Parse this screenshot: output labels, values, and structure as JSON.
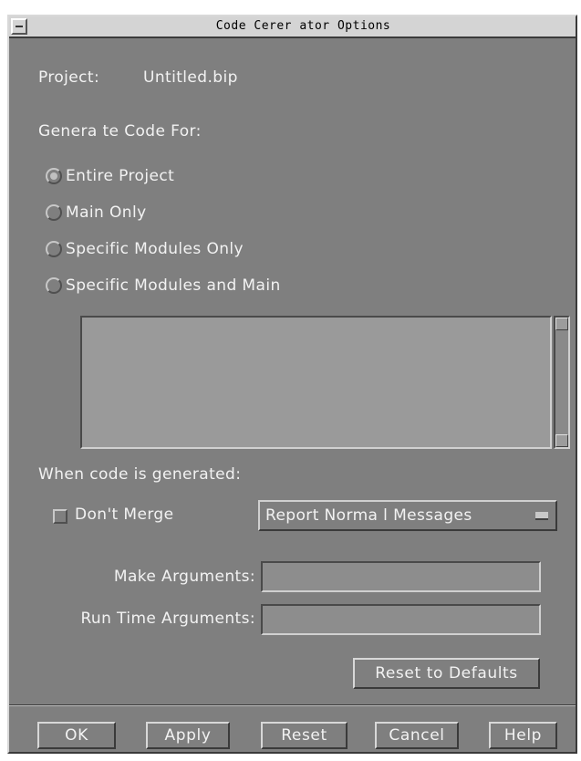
{
  "window": {
    "title": "Code Cerer ator Options"
  },
  "project": {
    "label": "Project:",
    "value": "Untitled.bip"
  },
  "generate": {
    "heading": "Genera te Code For:",
    "options": [
      {
        "label": "Entire Project",
        "checked": true
      },
      {
        "label": "Main Only",
        "checked": false
      },
      {
        "label": "Specific Modules Only",
        "checked": false
      },
      {
        "label": "Specific Modules and Main",
        "checked": false
      }
    ]
  },
  "when": {
    "heading": "When code is generated:",
    "dont_merge": {
      "label": "Don't Merge",
      "checked": false
    },
    "message_level": {
      "selected": "Report Norma l Messages"
    }
  },
  "make_args": {
    "label": "Make Arguments:",
    "value": ""
  },
  "runtime_args": {
    "label": "Run Time Arguments:",
    "value": ""
  },
  "reset_defaults": {
    "label": "Reset to Defaults"
  },
  "buttons": {
    "ok": "OK",
    "apply": "Apply",
    "reset": "Reset",
    "cancel": "Cancel",
    "help": "Help"
  }
}
